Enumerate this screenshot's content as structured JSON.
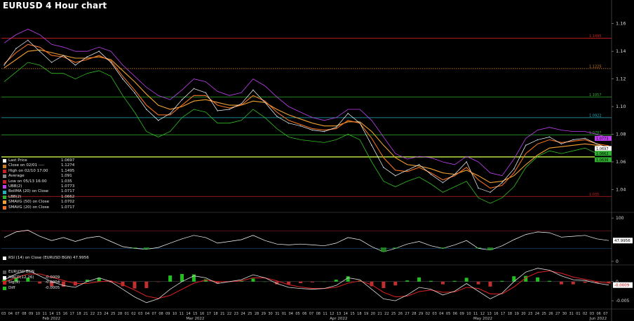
{
  "title": "EURUSD 4 Hour chart",
  "colors": {
    "background": "#000000",
    "price_line": "#ffffff",
    "bollinger_upper": "#c040f0",
    "bollinger_lower": "#30c020",
    "sma50": "#f0a030",
    "sma20": "#f07020",
    "level_red": "#cc2020",
    "level_orange": "#cc7a20",
    "level_green": "#30b030",
    "level_cyan": "#20b0c0",
    "macd_line": "#e0e0e0",
    "signal_line": "#d02020",
    "diff_pos": "#20c020",
    "rsi_line": "#ffffff",
    "rsi_low_fill": "#20a020"
  },
  "legend": [
    {
      "label": "Last Price",
      "value": "1.0697",
      "color": "#ffffff"
    },
    {
      "label": "Close on 02/01 ----",
      "value": "1.1274",
      "color": "#cc7a20"
    },
    {
      "label": "High on 02/10 17:00",
      "value": "1.1495",
      "color": "#cc2020"
    },
    {
      "label": "Average",
      "value": "1.091",
      "color": "#888888"
    },
    {
      "label": "Low on 05/13 16:00",
      "value": "1.035",
      "color": "#cc2020"
    },
    {
      "label": "UBB(2)",
      "value": "1.0773",
      "color": "#c040f0"
    },
    {
      "label": "BollMA (20) on Close",
      "value": "1.0717",
      "color": "#20b0c0"
    },
    {
      "label": "LBB(2)",
      "value": "1.0662",
      "color": "#30b030"
    },
    {
      "label": "SMAVG (50) on Close",
      "value": "1.0702",
      "color": "#f0a030"
    },
    {
      "label": "SMAVG (20) on Close",
      "value": "1.0717",
      "color": "#f07020"
    }
  ],
  "rsi_legend": "RSI (14) on Close (EURUSD BGN) 47.9956",
  "macd_legend": {
    "header": "EURUSD BGN",
    "rows": [
      {
        "label": "MACD(12,26)",
        "value": "-0.0009",
        "color": "#ffffff"
      },
      {
        "label": "Sig(9)",
        "value": "-0.0004",
        "color": "#d02020"
      },
      {
        "label": "Diff",
        "value": "-0.0005",
        "color": "#20c020"
      }
    ]
  },
  "chart_data": [
    {
      "type": "line",
      "title": "EURUSD 4 Hour chart",
      "y_axis_side": "right",
      "ylim": [
        1.025,
        1.17
      ],
      "yticks": [
        "1.16",
        "1.14",
        "1.12",
        "1.10",
        "1.08",
        "1.06",
        "1.04"
      ],
      "ytick_values": [
        1.16,
        1.14,
        1.12,
        1.1,
        1.08,
        1.06,
        1.04
      ],
      "horizontal_levels": [
        {
          "label": "1.1495",
          "value": 1.1495,
          "color": "#cc2020"
        },
        {
          "label": "1.1225",
          "value": 1.1275,
          "color": "#cc7a20"
        },
        {
          "label": "1.1057",
          "value": 1.107,
          "color": "#30b030"
        },
        {
          "label": "1.0922",
          "value": 1.092,
          "color": "#20b0c0"
        },
        {
          "label": "1.0787",
          "value": 1.0795,
          "color": "#30b030"
        },
        {
          "label": "1.035",
          "value": 1.035,
          "color": "#cc2020"
        }
      ],
      "price_tags": [
        {
          "label": "1.0773",
          "value": 1.077,
          "color": "#c040f0"
        },
        {
          "label": "1.0697",
          "value": 1.0697,
          "color": "#ffffff"
        },
        {
          "label": "1.0662",
          "value": 1.0662,
          "color": "#30b030"
        },
        {
          "label": "1.0636",
          "value": 1.0636,
          "color": "#30b030"
        }
      ],
      "series": [
        {
          "name": "Last Price",
          "values": [
            1.13,
            1.142,
            1.148,
            1.14,
            1.132,
            1.137,
            1.13,
            1.136,
            1.14,
            1.132,
            1.12,
            1.11,
            1.098,
            1.09,
            1.095,
            1.105,
            1.113,
            1.11,
            1.097,
            1.098,
            1.102,
            1.112,
            1.103,
            1.093,
            1.088,
            1.086,
            1.083,
            1.082,
            1.085,
            1.095,
            1.088,
            1.072,
            1.056,
            1.05,
            1.054,
            1.058,
            1.051,
            1.045,
            1.051,
            1.06,
            1.041,
            1.038,
            1.045,
            1.055,
            1.072,
            1.076,
            1.078,
            1.073,
            1.076,
            1.077,
            1.073,
            1.0697
          ]
        },
        {
          "name": "UBB(2)",
          "values": [
            1.146,
            1.152,
            1.156,
            1.152,
            1.145,
            1.143,
            1.14,
            1.14,
            1.143,
            1.14,
            1.13,
            1.122,
            1.114,
            1.108,
            1.105,
            1.112,
            1.12,
            1.118,
            1.111,
            1.108,
            1.11,
            1.12,
            1.115,
            1.107,
            1.1,
            1.096,
            1.092,
            1.09,
            1.092,
            1.098,
            1.098,
            1.09,
            1.078,
            1.066,
            1.062,
            1.064,
            1.063,
            1.06,
            1.058,
            1.064,
            1.06,
            1.052,
            1.05,
            1.062,
            1.077,
            1.083,
            1.085,
            1.083,
            1.082,
            1.082,
            1.08,
            1.0773
          ]
        },
        {
          "name": "LBB(2)",
          "values": [
            1.118,
            1.125,
            1.132,
            1.13,
            1.124,
            1.124,
            1.12,
            1.124,
            1.126,
            1.122,
            1.108,
            1.096,
            1.082,
            1.078,
            1.082,
            1.092,
            1.098,
            1.096,
            1.088,
            1.088,
            1.09,
            1.098,
            1.092,
            1.084,
            1.078,
            1.076,
            1.075,
            1.074,
            1.076,
            1.08,
            1.076,
            1.06,
            1.046,
            1.042,
            1.046,
            1.049,
            1.044,
            1.038,
            1.042,
            1.046,
            1.034,
            1.03,
            1.034,
            1.042,
            1.056,
            1.064,
            1.068,
            1.066,
            1.068,
            1.07,
            1.066,
            1.0662
          ]
        },
        {
          "name": "SMAVG (50) on Close",
          "values": [
            1.128,
            1.134,
            1.14,
            1.141,
            1.139,
            1.137,
            1.135,
            1.135,
            1.136,
            1.134,
            1.126,
            1.118,
            1.109,
            1.101,
            1.098,
            1.1,
            1.104,
            1.105,
            1.103,
            1.101,
            1.101,
            1.104,
            1.103,
            1.098,
            1.094,
            1.091,
            1.088,
            1.086,
            1.086,
            1.089,
            1.089,
            1.082,
            1.072,
            1.063,
            1.058,
            1.057,
            1.055,
            1.052,
            1.051,
            1.054,
            1.05,
            1.045,
            1.046,
            1.05,
            1.058,
            1.065,
            1.07,
            1.071,
            1.072,
            1.073,
            1.072,
            1.0702
          ]
        },
        {
          "name": "SMAVG (20) on Close",
          "values": [
            1.131,
            1.139,
            1.145,
            1.143,
            1.137,
            1.136,
            1.132,
            1.134,
            1.137,
            1.133,
            1.122,
            1.112,
            1.101,
            1.094,
            1.094,
            1.101,
            1.108,
            1.108,
            1.101,
            1.099,
            1.101,
            1.108,
            1.104,
            1.096,
            1.09,
            1.087,
            1.084,
            1.083,
            1.084,
            1.09,
            1.088,
            1.077,
            1.063,
            1.054,
            1.053,
            1.056,
            1.052,
            1.047,
            1.05,
            1.056,
            1.047,
            1.041,
            1.043,
            1.052,
            1.066,
            1.073,
            1.076,
            1.074,
            1.075,
            1.076,
            1.073,
            1.0717
          ]
        }
      ]
    },
    {
      "type": "line",
      "title": "RSI (14) on Close (EURUSD BGN)",
      "ylim": [
        -5,
        105
      ],
      "yticks": [
        "100",
        "0"
      ],
      "ytick_values": [
        100,
        0
      ],
      "levels": [
        70,
        30
      ],
      "last_value": "47.9956",
      "series": [
        {
          "name": "RSI (14) on Close",
          "values": [
            55,
            68,
            72,
            58,
            48,
            55,
            46,
            54,
            58,
            46,
            34,
            30,
            28,
            32,
            42,
            52,
            60,
            55,
            42,
            46,
            50,
            60,
            48,
            40,
            38,
            40,
            38,
            36,
            42,
            55,
            50,
            34,
            22,
            30,
            40,
            46,
            36,
            30,
            38,
            48,
            30,
            26,
            36,
            50,
            62,
            68,
            66,
            56,
            58,
            60,
            52,
            47.9956
          ]
        }
      ]
    },
    {
      "type": "bar",
      "title": "MACD(12,26)",
      "ylim": [
        -0.007,
        0.004
      ],
      "yticks": [
        "0",
        "-0.005"
      ],
      "ytick_values": [
        0,
        -0.005
      ],
      "last_value": "-0.0009",
      "series": [
        {
          "name": "MACD(12,26)",
          "values": [
            0.0005,
            0.002,
            0.003,
            0.0015,
            0.0,
            -0.001,
            -0.0015,
            0.0,
            0.001,
            0.0,
            -0.002,
            -0.004,
            -0.0055,
            -0.0045,
            -0.002,
            0.0,
            0.0015,
            0.001,
            -0.0005,
            0.0,
            0.0005,
            0.0018,
            0.001,
            -0.0005,
            -0.0015,
            -0.0018,
            -0.002,
            -0.0018,
            -0.001,
            0.001,
            0.0005,
            -0.002,
            -0.0045,
            -0.005,
            -0.0035,
            -0.0015,
            -0.002,
            -0.0035,
            -0.0025,
            -0.0005,
            -0.0025,
            -0.0045,
            -0.003,
            0.0,
            0.0025,
            0.0035,
            0.003,
            0.0015,
            0.0005,
            0.0003,
            -0.0004,
            -0.0009
          ]
        },
        {
          "name": "Sig(9)",
          "values": [
            0.0,
            0.001,
            0.002,
            0.002,
            0.0012,
            0.0003,
            -0.0005,
            -0.0005,
            0.0,
            0.0002,
            -0.0008,
            -0.0022,
            -0.0038,
            -0.0044,
            -0.0036,
            -0.002,
            -0.0004,
            0.0004,
            0.0,
            0.0,
            0.0002,
            0.001,
            0.001,
            0.0002,
            -0.0008,
            -0.0014,
            -0.0018,
            -0.0018,
            -0.0015,
            -0.0004,
            0.0002,
            -0.0008,
            -0.0028,
            -0.004,
            -0.0038,
            -0.0026,
            -0.0022,
            -0.0028,
            -0.0027,
            -0.0015,
            -0.0018,
            -0.0032,
            -0.0032,
            -0.0014,
            0.001,
            0.0024,
            0.0028,
            0.0022,
            0.0012,
            0.0006,
            0.0,
            -0.0004
          ]
        },
        {
          "name": "Diff",
          "values": [
            0.0005,
            0.001,
            0.001,
            -0.0005,
            -0.0012,
            -0.0013,
            -0.001,
            0.0005,
            0.001,
            -0.0002,
            -0.0012,
            -0.0018,
            -0.0017,
            -0.0001,
            0.0016,
            0.002,
            0.0019,
            0.0006,
            -0.0005,
            0.0,
            0.0003,
            0.0008,
            0.0,
            -0.0007,
            -0.0007,
            -0.0004,
            -0.0002,
            0.0,
            0.0005,
            0.0014,
            0.0003,
            -0.0012,
            -0.0017,
            -0.001,
            0.0003,
            0.0011,
            0.0002,
            -0.0007,
            0.0002,
            0.001,
            -0.0007,
            -0.0013,
            0.0002,
            0.0014,
            0.0015,
            0.0011,
            0.0002,
            -0.0007,
            -0.0007,
            -0.0003,
            -0.0004,
            -0.0005
          ]
        }
      ]
    }
  ],
  "x_axis": {
    "days": [
      "03",
      "04",
      "07",
      "08",
      "09",
      "10",
      "11",
      "14",
      "15",
      "16",
      "17",
      "18",
      "21",
      "22",
      "23",
      "24",
      "25",
      "28",
      "01",
      "02",
      "03",
      "04",
      "07",
      "08",
      "09",
      "10",
      "11",
      "14",
      "15",
      "16",
      "17",
      "18",
      "21",
      "22",
      "23",
      "24",
      "25",
      "28",
      "29",
      "30",
      "31",
      "01",
      "04",
      "05",
      "06",
      "07",
      "08",
      "11",
      "12",
      "13",
      "14",
      "15",
      "18",
      "19",
      "20",
      "21",
      "22",
      "25",
      "26",
      "27",
      "28",
      "29",
      "02",
      "03",
      "04",
      "05",
      "06",
      "09",
      "10",
      "11",
      "12",
      "13",
      "16",
      "17",
      "18",
      "19",
      "20",
      "23",
      "24",
      "25",
      "26",
      "27",
      "30",
      "31",
      "01",
      "02",
      "03",
      "06",
      "07"
    ],
    "months": [
      {
        "label": "Feb 2022",
        "day_index": 6
      },
      {
        "label": "Mar 2022",
        "day_index": 27
      },
      {
        "label": "Apr 2022",
        "day_index": 48
      },
      {
        "label": "May 2022",
        "day_index": 69
      },
      {
        "label": "Jun 2022",
        "day_index": 86
      }
    ]
  }
}
